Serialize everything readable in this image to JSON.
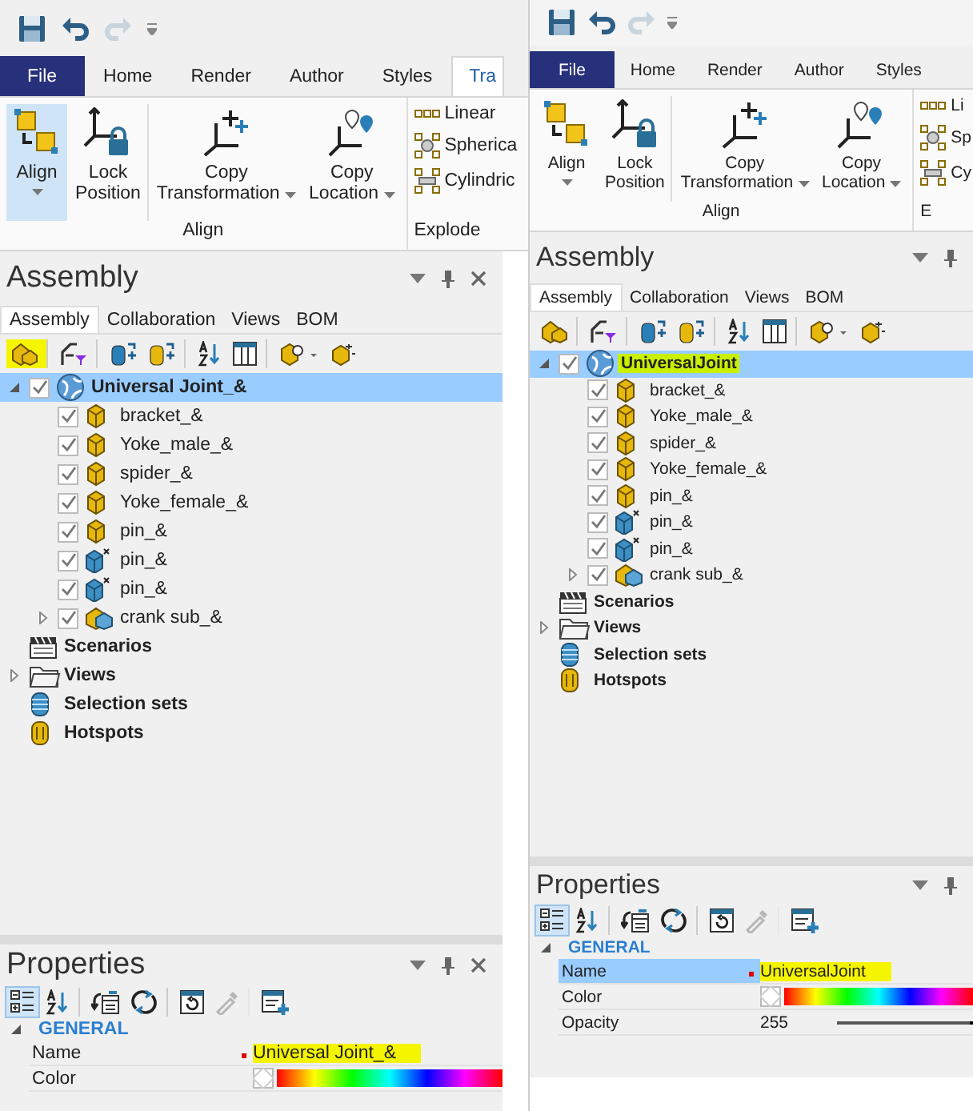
{
  "panes": [
    {
      "quick_access": {
        "redo_disabled": true
      },
      "ribbon_tabs": [
        {
          "label": "File",
          "kind": "file",
          "selected": false
        },
        {
          "label": "Home",
          "kind": "tab",
          "selected": false
        },
        {
          "label": "Render",
          "kind": "tab",
          "selected": false
        },
        {
          "label": "Author",
          "kind": "tab",
          "selected": false
        },
        {
          "label": "Styles",
          "kind": "tab",
          "selected": false
        },
        {
          "label": "Tra",
          "kind": "tab",
          "selected": true
        }
      ],
      "ribbon_groups": [
        {
          "label": "Align",
          "items": [
            {
              "kind": "large",
              "label": "Align",
              "dropdown": true,
              "selected": true
            },
            {
              "kind": "large",
              "label": "Lock\nPosition",
              "dropdown": false,
              "selected": false
            },
            {
              "kind": "large",
              "label": "Copy\nTransformation",
              "dropdown": true,
              "selected": false
            },
            {
              "kind": "large",
              "label": "Copy\nLocation",
              "dropdown": true,
              "selected": false
            }
          ]
        },
        {
          "label": "Explode",
          "items": [
            {
              "kind": "small",
              "label": "Linear"
            },
            {
              "kind": "small",
              "label": "Spherica"
            },
            {
              "kind": "small",
              "label": "Cylindric"
            }
          ]
        }
      ],
      "assembly": {
        "title": "Assembly",
        "close_button": true,
        "tabs": [
          {
            "label": "Assembly",
            "selected": true
          },
          {
            "label": "Collaboration",
            "selected": false
          },
          {
            "label": "Views",
            "selected": false
          },
          {
            "label": "BOM",
            "selected": false
          }
        ],
        "toolbar": [
          {
            "highlighted": true
          },
          {
            "highlighted": false
          },
          {
            "highlighted": false
          },
          {
            "highlighted": false
          },
          {
            "highlighted": false
          },
          {
            "highlighted": false
          },
          {
            "highlighted": false
          },
          {
            "highlighted": false
          }
        ],
        "tree": [
          {
            "label": "Universal Joint_&",
            "kind": "globe",
            "checked": true,
            "expanded": true,
            "selected": true,
            "highlighted": false,
            "children": [
              {
                "label": "bracket_&",
                "kind": "part",
                "checked": true,
                "selected": false,
                "highlighted": false
              },
              {
                "label": "Yoke_male_&",
                "kind": "part",
                "checked": true,
                "selected": false,
                "highlighted": false
              },
              {
                "label": "spider_&",
                "kind": "part",
                "checked": true,
                "selected": false,
                "highlighted": false
              },
              {
                "label": "Yoke_female_&",
                "kind": "part",
                "checked": true,
                "selected": false,
                "highlighted": false
              },
              {
                "label": "pin_&",
                "kind": "part",
                "checked": true,
                "selected": false,
                "highlighted": false
              },
              {
                "label": "pin_&",
                "kind": "part-x",
                "checked": true,
                "selected": false,
                "highlighted": false
              },
              {
                "label": "pin_&",
                "kind": "part-x",
                "checked": true,
                "selected": false,
                "highlighted": false
              },
              {
                "label": "crank sub_&",
                "kind": "subassembly",
                "checked": true,
                "expanded": false,
                "selected": false,
                "highlighted": false
              }
            ]
          },
          {
            "label": "Scenarios",
            "kind": "clapper",
            "selected": false,
            "highlighted": false
          },
          {
            "label": "Views",
            "kind": "folder",
            "expanded": false,
            "selected": false,
            "highlighted": false
          },
          {
            "label": "Selection sets",
            "kind": "stack",
            "selected": false,
            "highlighted": false
          },
          {
            "label": "Hotspots",
            "kind": "hotspot",
            "selected": false,
            "highlighted": false
          }
        ]
      },
      "properties": {
        "title": "Properties",
        "close_button": true,
        "toolbar": [
          {
            "pressed": true,
            "disabled": false
          },
          {
            "pressed": false,
            "disabled": false
          },
          {
            "pressed": false,
            "disabled": false
          },
          {
            "pressed": false,
            "disabled": false
          },
          {
            "pressed": false,
            "disabled": false
          },
          {
            "pressed": false,
            "disabled": true
          },
          {
            "pressed": false,
            "disabled": false
          }
        ],
        "category": "GENERAL",
        "expanded": true,
        "rows": [
          {
            "name": "Name",
            "kind": "text",
            "value": "Universal Joint_&",
            "selected": false,
            "modified": true,
            "highlighted": true
          },
          {
            "name": "Color",
            "kind": "color",
            "selected": false,
            "modified": false
          }
        ]
      }
    },
    {
      "quick_access": {
        "redo_disabled": true
      },
      "ribbon_tabs": [
        {
          "label": "File",
          "kind": "file",
          "selected": false
        },
        {
          "label": "Home",
          "kind": "tab",
          "selected": false
        },
        {
          "label": "Render",
          "kind": "tab",
          "selected": false
        },
        {
          "label": "Author",
          "kind": "tab",
          "selected": false
        },
        {
          "label": "Styles",
          "kind": "tab",
          "selected": false
        }
      ],
      "ribbon_groups": [
        {
          "label": "Align",
          "items": [
            {
              "kind": "large",
              "label": "Align",
              "dropdown": true,
              "selected": false
            },
            {
              "kind": "large",
              "label": "Lock\nPosition",
              "dropdown": false,
              "selected": false
            },
            {
              "kind": "large",
              "label": "Copy\nTransformation",
              "dropdown": true,
              "selected": false
            },
            {
              "kind": "large",
              "label": "Copy\nLocation",
              "dropdown": true,
              "selected": false
            }
          ]
        },
        {
          "label": "E",
          "items": [
            {
              "kind": "small",
              "label": "Li"
            },
            {
              "kind": "small",
              "label": "Sp"
            },
            {
              "kind": "small",
              "label": "Cy"
            }
          ]
        }
      ],
      "assembly": {
        "title": "Assembly",
        "close_button": false,
        "tabs": [
          {
            "label": "Assembly",
            "selected": true
          },
          {
            "label": "Collaboration",
            "selected": false
          },
          {
            "label": "Views",
            "selected": false
          },
          {
            "label": "BOM",
            "selected": false
          }
        ],
        "toolbar": [
          {
            "highlighted": false
          },
          {
            "highlighted": false
          },
          {
            "highlighted": false
          },
          {
            "highlighted": false
          },
          {
            "highlighted": false
          },
          {
            "highlighted": false
          },
          {
            "highlighted": false
          },
          {
            "highlighted": false
          }
        ],
        "tree": [
          {
            "label": "UniversalJoint",
            "kind": "globe",
            "checked": true,
            "expanded": true,
            "selected": true,
            "highlighted": true,
            "children": [
              {
                "label": "bracket_&",
                "kind": "part",
                "checked": true,
                "selected": false,
                "highlighted": false
              },
              {
                "label": "Yoke_male_&",
                "kind": "part",
                "checked": true,
                "selected": false,
                "highlighted": false
              },
              {
                "label": "spider_&",
                "kind": "part",
                "checked": true,
                "selected": false,
                "highlighted": false
              },
              {
                "label": "Yoke_female_&",
                "kind": "part",
                "checked": true,
                "selected": false,
                "highlighted": false
              },
              {
                "label": "pin_&",
                "kind": "part",
                "checked": true,
                "selected": false,
                "highlighted": false
              },
              {
                "label": "pin_&",
                "kind": "part-x",
                "checked": true,
                "selected": false,
                "highlighted": false
              },
              {
                "label": "pin_&",
                "kind": "part-x",
                "checked": true,
                "selected": false,
                "highlighted": false
              },
              {
                "label": "crank sub_&",
                "kind": "subassembly",
                "checked": true,
                "expanded": false,
                "selected": false,
                "highlighted": false
              }
            ]
          },
          {
            "label": "Scenarios",
            "kind": "clapper",
            "selected": false,
            "highlighted": false
          },
          {
            "label": "Views",
            "kind": "folder",
            "expanded": false,
            "selected": false,
            "highlighted": false
          },
          {
            "label": "Selection sets",
            "kind": "stack",
            "selected": false,
            "highlighted": false
          },
          {
            "label": "Hotspots",
            "kind": "hotspot",
            "selected": false,
            "highlighted": false
          }
        ]
      },
      "properties": {
        "title": "Properties",
        "close_button": false,
        "toolbar": [
          {
            "pressed": true,
            "disabled": false
          },
          {
            "pressed": false,
            "disabled": false
          },
          {
            "pressed": false,
            "disabled": false
          },
          {
            "pressed": false,
            "disabled": false
          },
          {
            "pressed": false,
            "disabled": false
          },
          {
            "pressed": false,
            "disabled": true
          },
          {
            "pressed": false,
            "disabled": false
          }
        ],
        "category": "GENERAL",
        "expanded": true,
        "rows": [
          {
            "name": "Name",
            "kind": "text",
            "value": "UniversalJoint",
            "selected": true,
            "modified": true,
            "highlighted": true
          },
          {
            "name": "Color",
            "kind": "color",
            "selected": false,
            "modified": false
          },
          {
            "name": "Opacity",
            "kind": "slider",
            "value": "255",
            "level": 1,
            "selected": false,
            "modified": false
          }
        ]
      }
    }
  ]
}
